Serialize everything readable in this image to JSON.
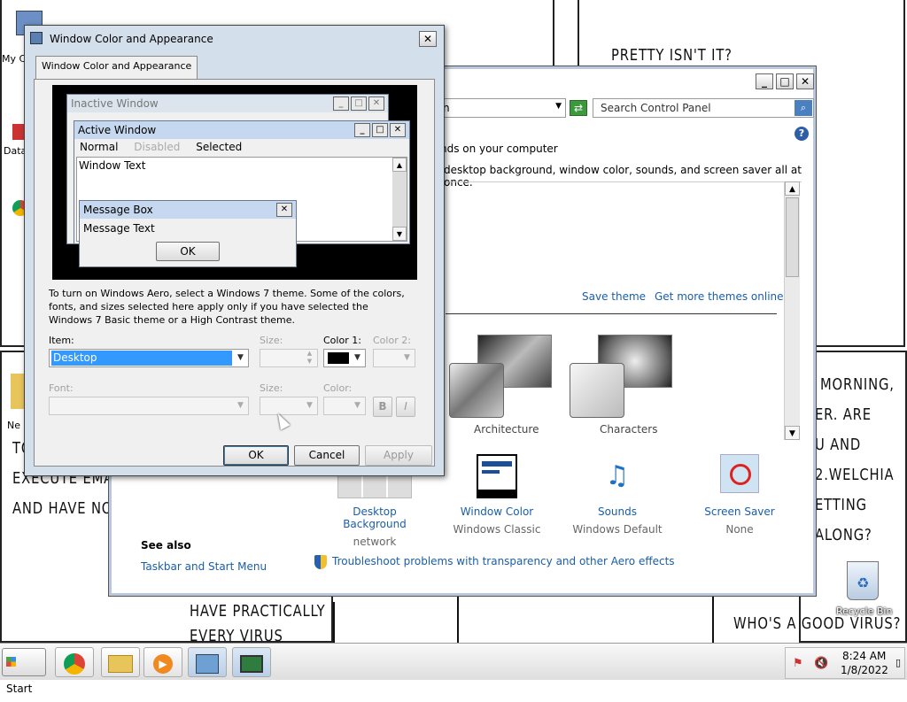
{
  "comic": {
    "text_pretty": "PRETTY ISN'T IT?",
    "text_morning": [
      "MORNING,",
      "ER.  ARE",
      "U  AND",
      "2.WELCHIA",
      "ETTING",
      "ALONG?"
    ],
    "text_have": [
      "HAVE  PRACTICALLY",
      "EVERY VIRUS"
    ],
    "text_who": "WHO'S A GOOD VIRUS?",
    "text_left": [
      "TO",
      "EXECUTE EMAIL",
      "AND HAVE NO S"
    ]
  },
  "desktop_icons": {
    "my_computer": "My C",
    "data": "Data",
    "ne": "Ne",
    "recycle_bin": "Recycle Bin"
  },
  "control_panel": {
    "address_text": "n",
    "search_placeholder": "Search Control Panel",
    "heading_fragment": "nds on your computer",
    "description_fragment": " desktop background, window color, sounds, and screen saver all at once.",
    "save_theme": "Save theme",
    "get_more_themes": "Get more themes online",
    "themes": [
      {
        "label": "Architecture"
      },
      {
        "label": "Characters"
      }
    ],
    "bottom_items": [
      {
        "title": "Desktop Background",
        "subtitle": "network"
      },
      {
        "title": "Window Color",
        "subtitle": "Windows Classic"
      },
      {
        "title": "Sounds",
        "subtitle": "Windows Default"
      },
      {
        "title": "Screen Saver",
        "subtitle": "None"
      }
    ],
    "see_also": "See also",
    "taskbar_link": "Taskbar and Start Menu",
    "troubleshoot_link": "Troubleshoot problems with transparency and other Aero effects"
  },
  "dialog": {
    "title": "Window Color and Appearance",
    "tab": "Window Color and Appearance",
    "preview": {
      "inactive": "Inactive Window",
      "active": "Active Window",
      "menu_normal": "Normal",
      "menu_disabled": "Disabled",
      "menu_selected": "Selected",
      "window_text": "Window Text",
      "message_box": "Message Box",
      "message_text": "Message Text",
      "ok": "OK"
    },
    "info_text": "To turn on Windows Aero, select a Windows 7 theme.  Some of the colors, fonts, and sizes selected here apply only if you have selected the Windows 7 Basic theme or a High Contrast theme.",
    "item_label": "Item:",
    "item_value": "Desktop",
    "size_label": "Size:",
    "color1_label": "Color 1:",
    "color2_label": "Color 2:",
    "font_label": "Font:",
    "size2_label": "Size:",
    "color_label": "Color:",
    "bold": "B",
    "italic": "I",
    "ok": "OK",
    "cancel": "Cancel",
    "apply": "Apply",
    "color1_value": "#000000"
  },
  "taskbar": {
    "start": "Start",
    "time": "8:24 AM",
    "date": "1/8/2022"
  },
  "colors": {
    "accent": "#1a5ea8",
    "selection": "#3399ff",
    "titlebar_active": "#c6d8ef"
  }
}
